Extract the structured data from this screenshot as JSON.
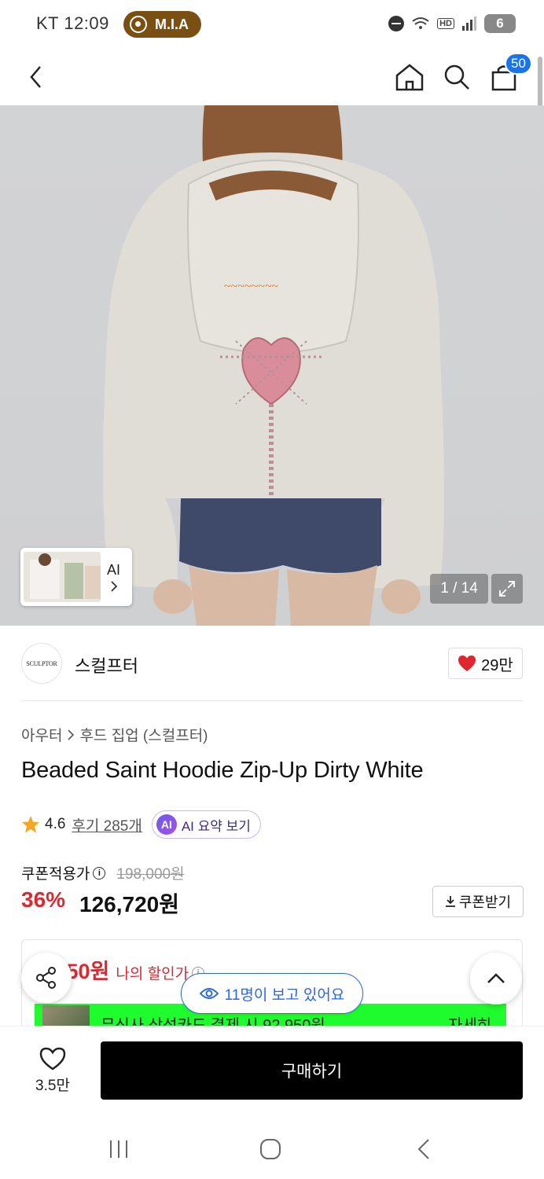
{
  "status_bar": {
    "carrier_time": "KT 12:09",
    "recording_label": "M.I.A",
    "hd_label": "HD",
    "battery_level": "6"
  },
  "nav": {
    "cart_count": "50"
  },
  "gallery": {
    "thumb_label": "AI",
    "counter": "1 / 14"
  },
  "brand": {
    "logo_text": "SCULPTOR",
    "name": "스컬프터",
    "like_count": "29만"
  },
  "product": {
    "breadcrumb": [
      "아우터",
      "후드 집업 (스컬프터)"
    ],
    "title": "Beaded Saint Hoodie Zip-Up Dirty White",
    "rating": "4.6",
    "review_link": "후기 285개",
    "ai_summary_badge": "AI",
    "ai_summary_label": "AI 요약 보기"
  },
  "price": {
    "coupon_label": "쿠폰적용가",
    "original": "198,000원",
    "discount": "36%",
    "final": "126,720원",
    "coupon_button": "쿠폰받기"
  },
  "benefit": {
    "my_price": ",950원",
    "my_price_label": "나의 할인가",
    "card_text": "무신사 삼성카드 결제 시 92,950원",
    "detail_link": "자세히"
  },
  "floating": {
    "viewers_text": "11명이 보고 있어요"
  },
  "bottom_bar": {
    "heart_count": "3.5만",
    "buy_button": "구매하기"
  },
  "colors": {
    "accent_red": "#e0262f",
    "accent_blue": "#2a66e8",
    "card_green": "#1efc2e",
    "badge_blue": "#1a73e8"
  }
}
